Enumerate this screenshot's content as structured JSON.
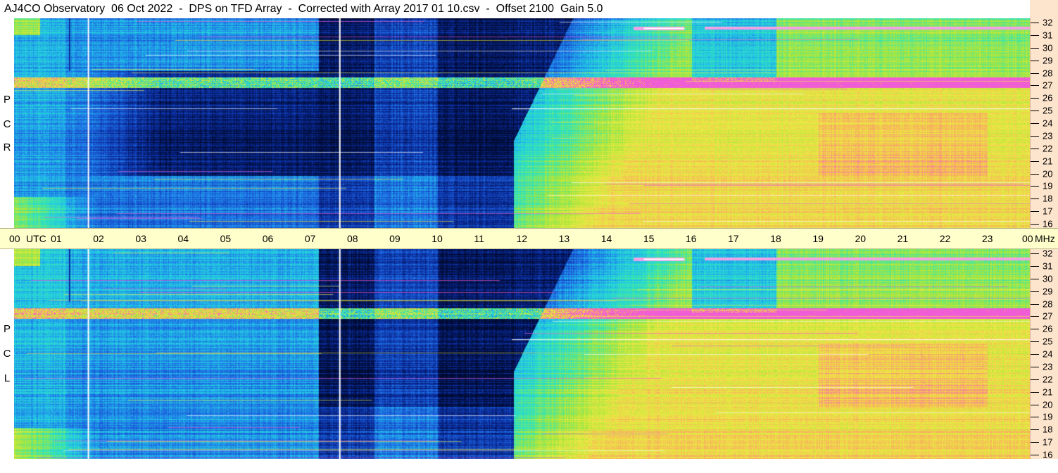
{
  "title": "AJ4CO Observatory  06 Oct 2022  -  DPS on TFD Array  -  Corrected with Array 2017 01 10.csv  -  Offset 2100  Gain 5.0",
  "chart_data": [
    {
      "type": "heatmap",
      "panel": "RCP",
      "side_label": [
        "R",
        "C",
        "P"
      ],
      "x_axis": {
        "unit_label": "UTC",
        "ticks": [
          "00",
          "01",
          "02",
          "03",
          "04",
          "05",
          "06",
          "07",
          "08",
          "09",
          "10",
          "11",
          "12",
          "13",
          "14",
          "15",
          "16",
          "17",
          "18",
          "19",
          "20",
          "21",
          "22",
          "23",
          "00"
        ]
      },
      "y_axis": {
        "unit_label": "MHz",
        "range": [
          16,
          32
        ],
        "ticks": [
          16,
          17,
          18,
          19,
          20,
          21,
          22,
          23,
          24,
          25,
          26,
          27,
          28,
          29,
          30,
          31,
          32
        ]
      },
      "colormap": [
        "#000a30",
        "#0a2a9a",
        "#1e6ae6",
        "#22c6e8",
        "#34e6b4",
        "#a8e63a",
        "#ecea44",
        "#f8b05a",
        "#f05ad8",
        "#ffffff"
      ]
    },
    {
      "type": "heatmap",
      "panel": "LCP",
      "side_label": [
        "L",
        "C",
        "P"
      ],
      "x_axis": {
        "unit_label": "UTC",
        "ticks": [
          "00",
          "01",
          "02",
          "03",
          "04",
          "05",
          "06",
          "07",
          "08",
          "09",
          "10",
          "11",
          "12",
          "13",
          "14",
          "15",
          "16",
          "17",
          "18",
          "19",
          "20",
          "21",
          "22",
          "23",
          "00"
        ]
      },
      "y_axis": {
        "unit_label": "MHz",
        "range": [
          16,
          32
        ],
        "ticks": [
          16,
          17,
          18,
          19,
          20,
          21,
          22,
          23,
          24,
          25,
          26,
          27,
          28,
          29,
          30,
          31,
          32
        ]
      },
      "colormap": [
        "#000a30",
        "#0a2a9a",
        "#1e6ae6",
        "#22c6e8",
        "#34e6b4",
        "#a8e63a",
        "#ecea44",
        "#f8b05a",
        "#f05ad8",
        "#ffffff"
      ]
    }
  ]
}
